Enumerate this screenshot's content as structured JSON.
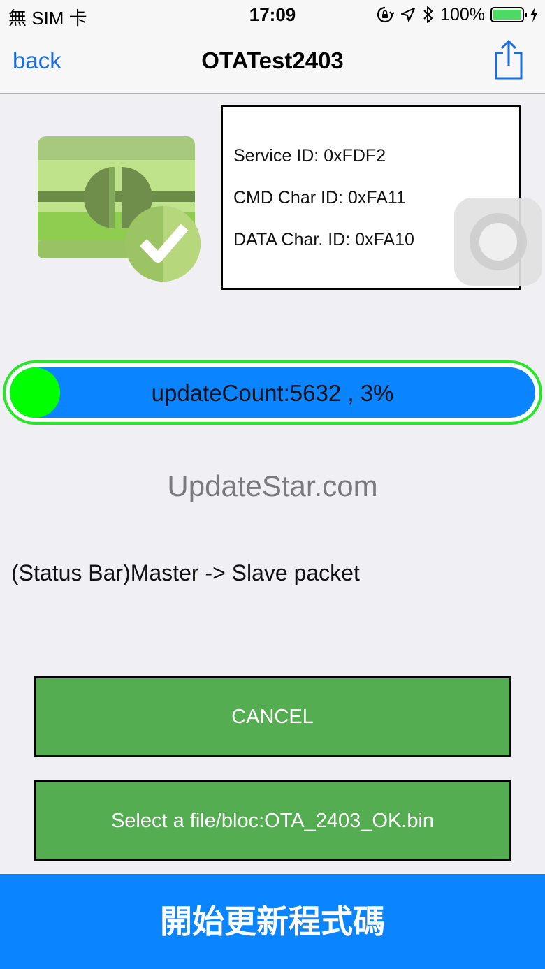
{
  "status_bar": {
    "carrier": "無 SIM 卡",
    "time": "17:09",
    "battery_percent": "100%",
    "icons": [
      "orientation-lock-icon",
      "location-arrow-icon",
      "bluetooth-icon",
      "battery-icon",
      "charging-bolt-icon"
    ]
  },
  "nav": {
    "back_label": "back",
    "title": "OTATest2403",
    "share_icon": "share-icon"
  },
  "info": {
    "service_id": "Service ID: 0xFDF2",
    "cmd_char_id": "CMD Char ID: 0xFA11",
    "data_char_id": "DATA Char. ID: 0xFA10"
  },
  "progress": {
    "text": "updateCount:5632 , 3%",
    "percent": 3
  },
  "watermark": "UpdateStar.com",
  "status_text": "(Status Bar)Master -> Slave packet",
  "buttons": {
    "cancel": "CANCEL",
    "select_file": "Select a file/bloc:OTA_2403_OK.bin",
    "start_update": "開始更新程式碼"
  },
  "colors": {
    "accent_blue": "#0a84ff",
    "button_green": "#55ad52",
    "progress_border": "#27e627",
    "progress_fill": "#00ff00",
    "battery_green": "#4cd964"
  }
}
